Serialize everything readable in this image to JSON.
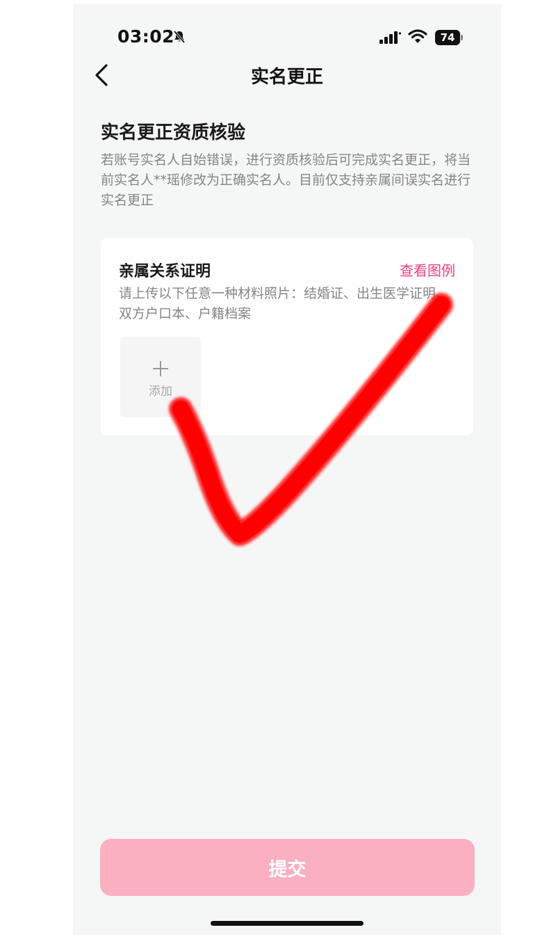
{
  "status_bar": {
    "time": "03:02",
    "battery_level": "74",
    "icons": [
      "bell-muted-icon",
      "cellular-signal-icon",
      "wifi-icon",
      "battery-icon"
    ]
  },
  "nav": {
    "title": "实名更正",
    "back_icon": "chevron-left-icon"
  },
  "section": {
    "title": "实名更正资质核验",
    "description": "若账号实名人自始错误，进行资质核验后可完成实名更正，将当前实名人**瑶修改为正确实名人。目前仅支持亲属间误实名进行实名更正"
  },
  "card": {
    "title": "亲属关系证明",
    "view_example_label": "查看图例",
    "description": "请上传以下任意一种材料照片：结婚证、出生医学证明、双方户口本、户籍档案",
    "add_label": "添加",
    "add_icon": "plus-icon"
  },
  "overlay": {
    "icon": "red-checkmark-icon",
    "color": "#ff0000"
  },
  "submit": {
    "label": "提交",
    "color": "#fbb0c2"
  },
  "colors": {
    "accent": "#e8447a",
    "background": "#f5f6f6"
  }
}
